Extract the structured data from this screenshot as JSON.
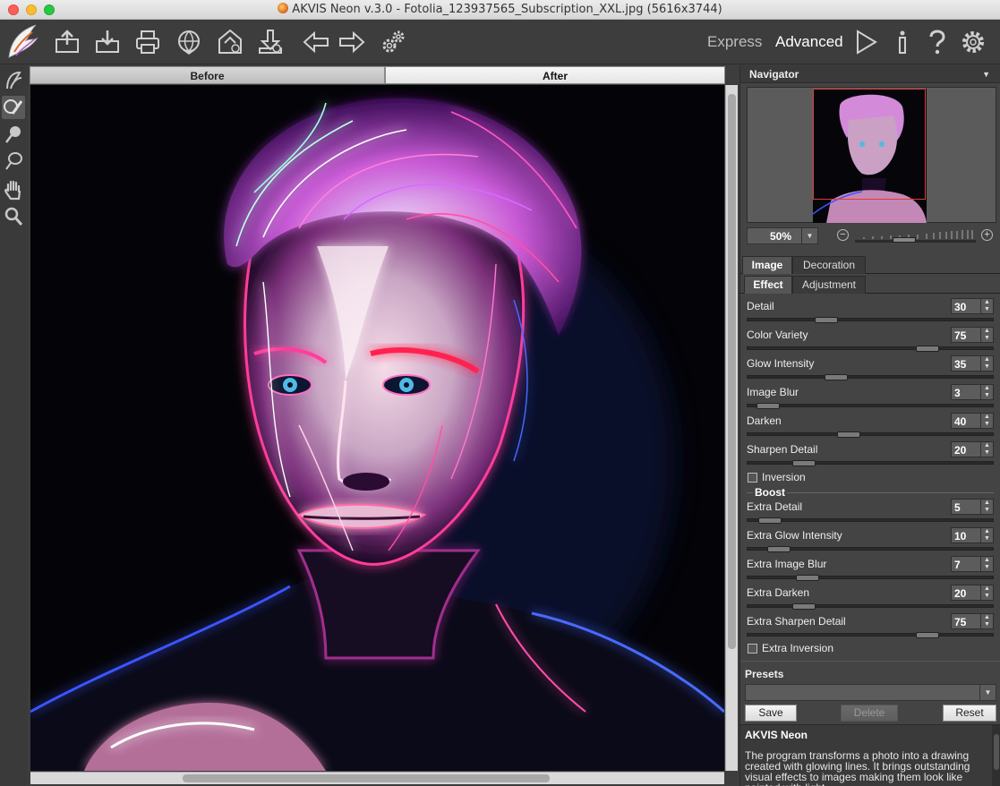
{
  "window": {
    "title": "AKVIS Neon v.3.0 - Fotolia_123937565_Subscription_XXL.jpg (5616x3744)"
  },
  "toolbar": {
    "buttons": [
      "logo-icon",
      "open-icon",
      "save-icon",
      "print-icon",
      "share-icon",
      "batch-icon",
      "plugin-icon",
      "back-icon",
      "forward-icon",
      "preferences-icon"
    ],
    "mode_express": "Express",
    "mode_advanced": "Advanced",
    "right_icons": [
      "run-icon",
      "info-icon",
      "help-icon",
      "settings-icon"
    ]
  },
  "tools": [
    "stroke-icon",
    "brush-icon",
    "eraser-icon",
    "lasso-icon",
    "hand-icon",
    "zoom-icon"
  ],
  "view_tabs": {
    "before": "Before",
    "after": "After"
  },
  "navigator": {
    "title": "Navigator",
    "zoom": "50%"
  },
  "panel_tabs": {
    "image": "Image",
    "decoration": "Decoration",
    "effect": "Effect",
    "adjustment": "Adjustment"
  },
  "params": [
    {
      "label": "Detail",
      "value": "30"
    },
    {
      "label": "Color Variety",
      "value": "75"
    },
    {
      "label": "Glow Intensity",
      "value": "35"
    },
    {
      "label": "Image Blur",
      "value": "3"
    },
    {
      "label": "Darken",
      "value": "40"
    },
    {
      "label": "Sharpen Detail",
      "value": "20"
    }
  ],
  "inversion_label": "Inversion",
  "boost_label": "Boost",
  "boost_params": [
    {
      "label": "Extra Detail",
      "value": "5"
    },
    {
      "label": "Extra Glow Intensity",
      "value": "10"
    },
    {
      "label": "Extra Image Blur",
      "value": "7"
    },
    {
      "label": "Extra Darken",
      "value": "20"
    },
    {
      "label": "Extra Sharpen Detail",
      "value": "75"
    }
  ],
  "extra_inversion_label": "Extra Inversion",
  "presets": {
    "title": "Presets",
    "selected": "",
    "save": "Save",
    "delete": "Delete",
    "reset": "Reset"
  },
  "help": {
    "title": "AKVIS Neon",
    "text": "The program transforms a photo into a drawing created with glowing lines. It brings outstanding visual effects to images making them look like painted with light."
  },
  "colors": {
    "accent_red": "#e23a3a",
    "panel_bg": "#444444",
    "neon_pink": "#ff2f9a",
    "neon_blue": "#3a5bff"
  }
}
